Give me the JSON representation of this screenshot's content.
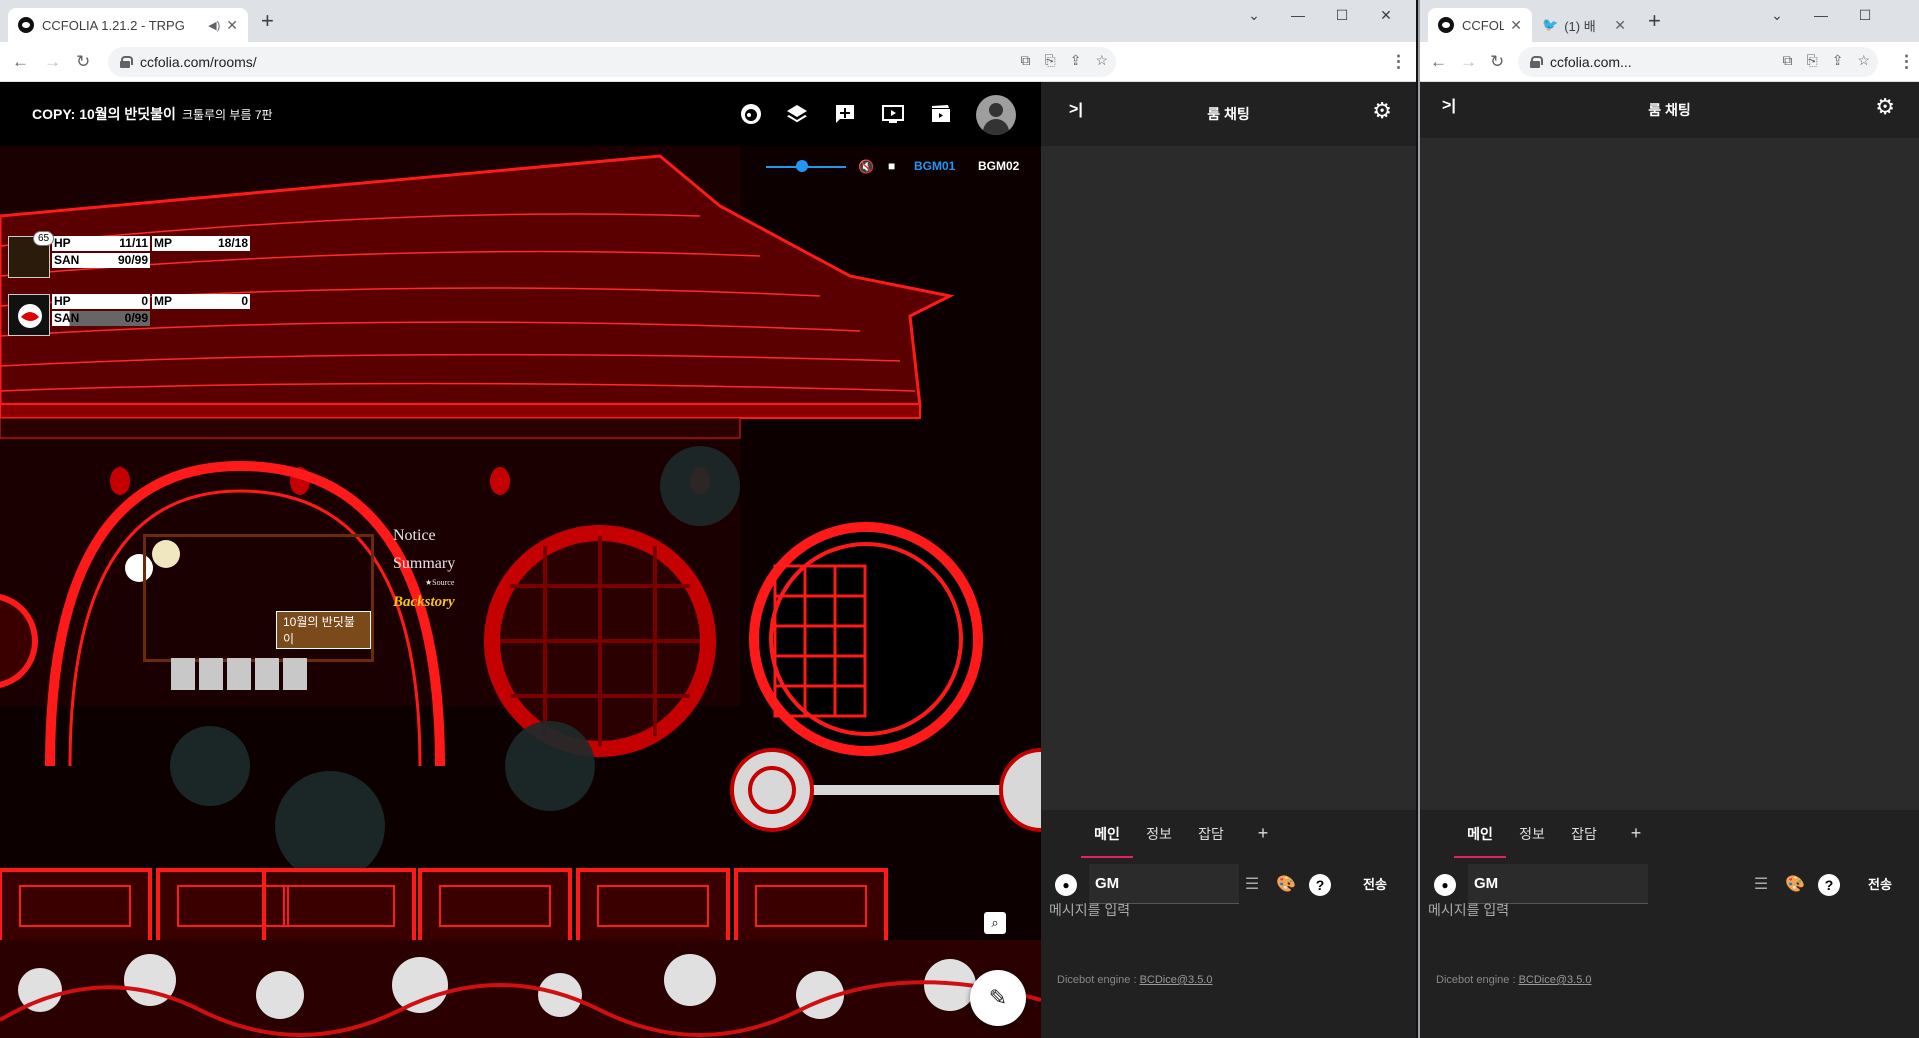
{
  "win1": {
    "tab_title": "CCFOLIA 1.21.2 - TRPG",
    "url": "ccfolia.com/rooms/",
    "room_title": "COPY: 10월의 반딧불이",
    "room_sub": "크툴루의 부름 7판"
  },
  "win2": {
    "tab1_title": "CCFOLI",
    "tab2_title": "(1) 배",
    "url": "ccfolia.com..."
  },
  "characters": [
    {
      "badge": "65",
      "hp_label": "HP",
      "hp": "11/11",
      "mp_label": "MP",
      "mp": "18/18",
      "san_label": "SAN",
      "san": "90/99"
    },
    {
      "badge": "",
      "hp_label": "HP",
      "hp": "0",
      "mp_label": "MP",
      "mp": "0",
      "san_label": "SAN",
      "san": "0/99"
    }
  ],
  "bgm": {
    "track1": "BGM01",
    "track2": "BGM02",
    "volume": 0.45,
    "active_color": "#2196f3"
  },
  "notice": {
    "notice": "Notice",
    "summary": "Summary",
    "source": "★Source",
    "backstory": "Backstory",
    "card_label": "10월의 반딧불이"
  },
  "chat": {
    "title": "룸 채팅",
    "collapse": ">|",
    "tabs": [
      "메인",
      "정보",
      "잡담"
    ],
    "add_tab": "+",
    "name": "GM",
    "send": "전송",
    "placeholder": "메시지를 입력",
    "dice_prefix": "Dicebot engine : ",
    "dice_engine": "BCDice@3.5.0"
  },
  "colors": {
    "accent": "#e91e63",
    "bg_chat": "#2b2b2b",
    "header": "#212121"
  }
}
